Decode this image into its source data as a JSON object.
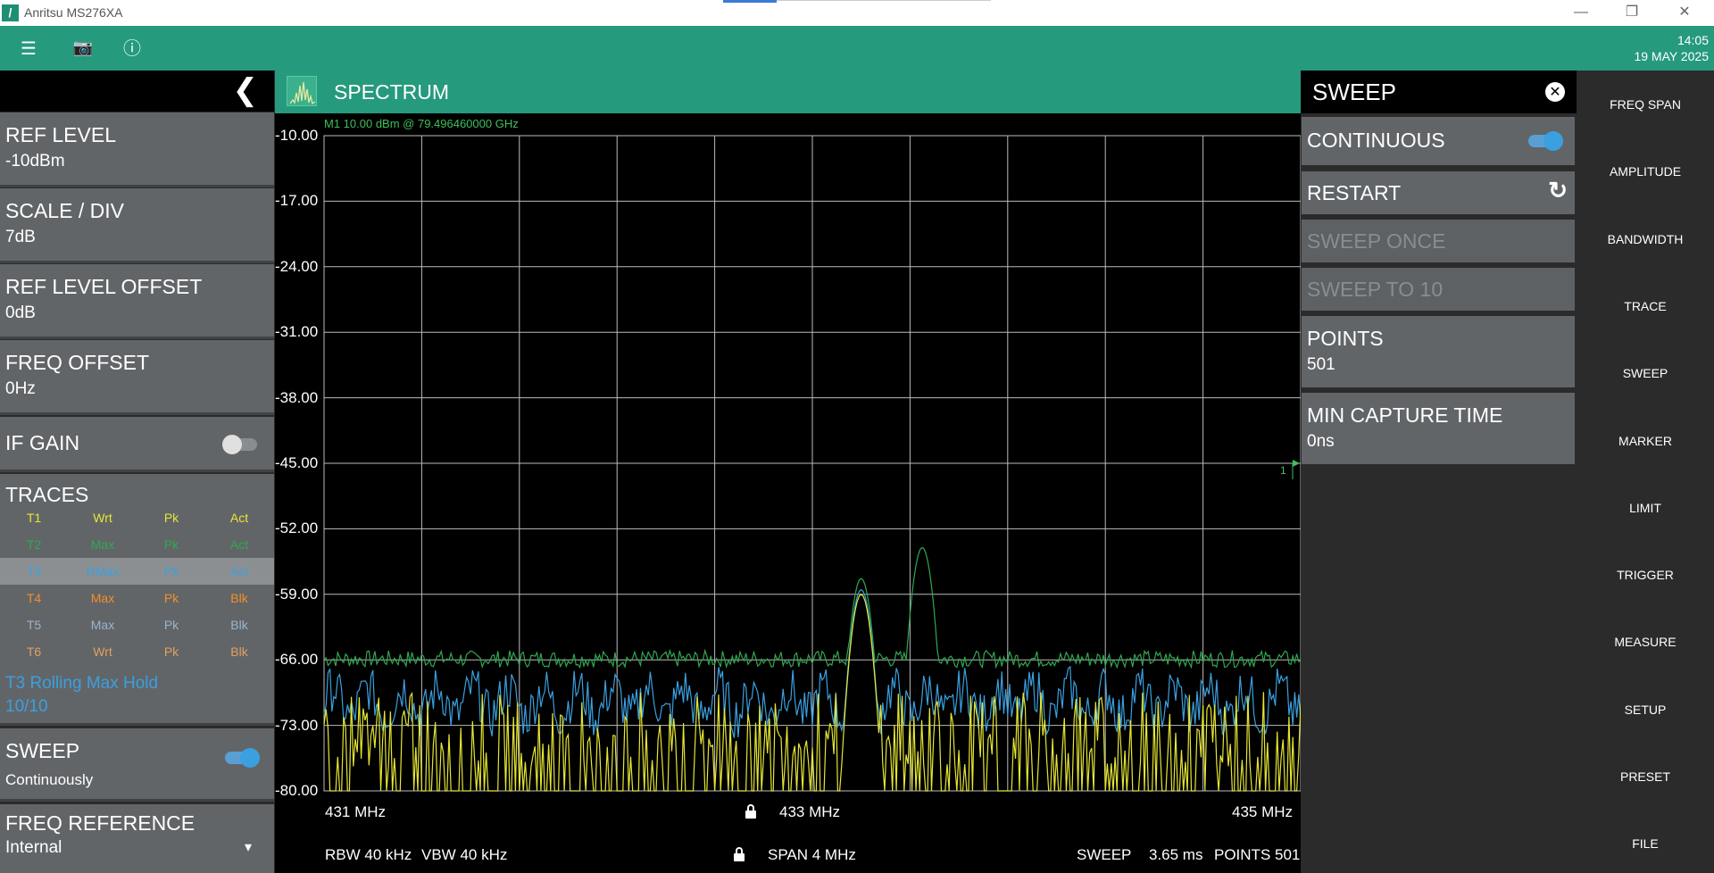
{
  "titlebar": {
    "title": "Anritsu MS276XA",
    "minimize": "—",
    "restore": "❐",
    "close": "✕"
  },
  "appbar": {
    "menu_icon": "☰",
    "camera_icon": "📷",
    "info_icon": "ⓘ",
    "time": "14:05",
    "date": "19 MAY 2025"
  },
  "left_panel": {
    "back_icon": "❮",
    "ref_level": {
      "label": "REF LEVEL",
      "value": "-10dBm"
    },
    "scale_div": {
      "label": "SCALE / DIV",
      "value": "7dB"
    },
    "ref_level_offset": {
      "label": "REF LEVEL OFFSET",
      "value": "0dB"
    },
    "freq_offset": {
      "label": "FREQ OFFSET",
      "value": "0Hz"
    },
    "if_gain": {
      "label": "IF GAIN",
      "on": false
    },
    "traces": {
      "label": "TRACES",
      "rows": [
        {
          "id": "T1",
          "mode": "Wrt",
          "det": "Pk",
          "state": "Act",
          "color": "#e6e633"
        },
        {
          "id": "T2",
          "mode": "Max",
          "det": "Pk",
          "state": "Act",
          "color": "#2fa84f"
        },
        {
          "id": "T3",
          "mode": "RMax",
          "det": "Pk",
          "state": "Act",
          "color": "#3aa0e0"
        },
        {
          "id": "T4",
          "mode": "Max",
          "det": "Pk",
          "state": "Blk",
          "color": "#f0902a"
        },
        {
          "id": "T5",
          "mode": "Max",
          "det": "Pk",
          "state": "Blk",
          "color": "#9ab4cc"
        },
        {
          "id": "T6",
          "mode": "Wrt",
          "det": "Pk",
          "state": "Blk",
          "color": "#e0a060"
        }
      ],
      "note_line1": "T3 Rolling Max Hold",
      "note_line2": "10/10"
    },
    "sweep": {
      "label": "SWEEP",
      "value": "Continuously",
      "on": true
    },
    "freq_reference": {
      "label": "FREQ REFERENCE",
      "value": "Internal",
      "dropdown_icon": "▾"
    }
  },
  "spectrum": {
    "title": "SPECTRUM",
    "marker_text": "M1    10.00  dBm  @  79.496460000  GHz",
    "marker_flag": "1",
    "footer": {
      "start": "431 MHz",
      "center": "433 MHz",
      "stop": "435 MHz",
      "rbw": "RBW 40 kHz",
      "vbw": "VBW 40 kHz",
      "span": "SPAN 4 MHz",
      "sweep_label": "SWEEP",
      "sweep_time": "3.65 ms",
      "points": "POINTS 501"
    }
  },
  "chart_data": {
    "type": "line",
    "y_ticks": [
      "-10.00",
      "-17.00",
      "-24.00",
      "-31.00",
      "-38.00",
      "-45.00",
      "-52.00",
      "-59.00",
      "-66.00",
      "-73.00",
      "-80.00"
    ],
    "ylim": [
      -80,
      -10
    ],
    "xlim": [
      431,
      435
    ],
    "series": [
      {
        "color": "#2fa84f",
        "noise_floor": -65.9,
        "peaks": [
          {
            "x": 433.2,
            "y": -57.3
          },
          {
            "x": 433.45,
            "y": -54.0
          }
        ]
      },
      {
        "color": "#3aa0e0",
        "noise_floor": -70.5,
        "peaks": [
          {
            "x": 433.2,
            "y": -58.5
          }
        ]
      },
      {
        "color": "#e6e633",
        "noise_floor": -75,
        "peaks": [
          {
            "x": 433.2,
            "y": -59.0
          }
        ]
      }
    ]
  },
  "sweep_panel": {
    "title": "SWEEP",
    "close_icon": "✕",
    "continuous": {
      "label": "CONTINUOUS",
      "on": true
    },
    "restart": {
      "label": "RESTART",
      "icon": "↻"
    },
    "sweep_once": {
      "label": "SWEEP ONCE"
    },
    "sweep_to": {
      "label": "SWEEP TO 10"
    },
    "points": {
      "label": "POINTS",
      "value": "501"
    },
    "min_capture": {
      "label": "MIN CAPTURE TIME",
      "value": "0ns"
    }
  },
  "right_nav": [
    "FREQ SPAN",
    "AMPLITUDE",
    "BANDWIDTH",
    "TRACE",
    "SWEEP",
    "MARKER",
    "LIMIT",
    "TRIGGER",
    "MEASURE",
    "SETUP",
    "PRESET",
    "FILE"
  ]
}
